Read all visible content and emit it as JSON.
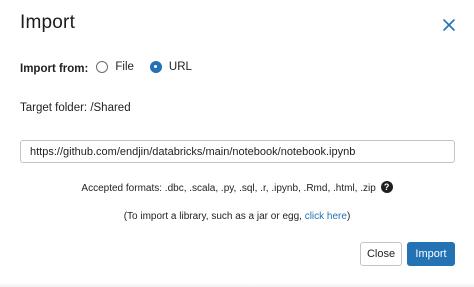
{
  "dialog": {
    "title": "Import",
    "import_from_label": "Import from:",
    "options": [
      {
        "label": "File",
        "selected": false
      },
      {
        "label": "URL",
        "selected": true
      }
    ],
    "target_folder": "Target folder: /Shared",
    "url_value": "https://github.com/endjin/databricks/main/notebook/notebook.ipynb",
    "accepted_formats": "Accepted formats: .dbc, .scala, .py, .sql, .r, .ipynb, .Rmd, .html, .zip",
    "help_glyph": "?",
    "library_prefix": "(To import a library, such as a jar or egg, ",
    "library_link": "click here",
    "library_suffix": ")",
    "close_button": "Close",
    "import_button": "Import",
    "accent_color": "#2272b4"
  }
}
